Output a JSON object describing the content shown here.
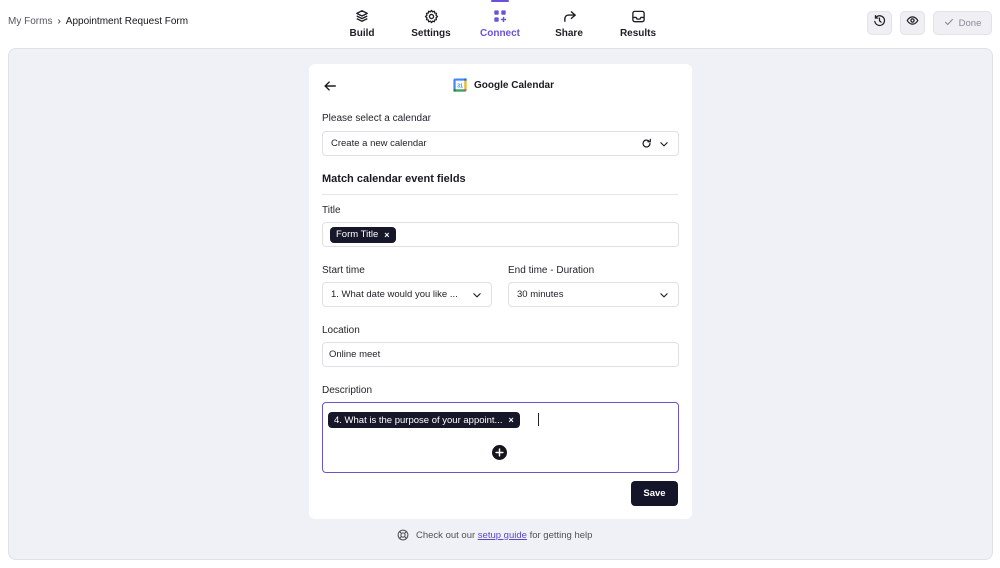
{
  "breadcrumb": {
    "root": "My Forms",
    "separator": "›",
    "current": "Appointment Request Form"
  },
  "nav": {
    "tabs": [
      {
        "label": "Build",
        "icon": "layers-icon",
        "active": false
      },
      {
        "label": "Settings",
        "icon": "gear-icon",
        "active": false
      },
      {
        "label": "Connect",
        "icon": "grid-plus-icon",
        "active": true
      },
      {
        "label": "Share",
        "icon": "share-arrow-icon",
        "active": false
      },
      {
        "label": "Results",
        "icon": "inbox-icon",
        "active": false
      }
    ]
  },
  "actions": {
    "history_icon": "history-icon",
    "preview_icon": "eye-icon",
    "done_label": "Done"
  },
  "panel": {
    "title": "Google Calendar",
    "calendar_label": "Please select a calendar",
    "calendar_value": "Create a new calendar",
    "section_title": "Match calendar event fields",
    "title_label": "Title",
    "title_chip": "Form Title",
    "start_label": "Start time",
    "start_value": "1. What date would you like ...",
    "end_label": "End time - Duration",
    "end_value": "30 minutes",
    "location_label": "Location",
    "location_value": "Online meet",
    "description_label": "Description",
    "description_chip": "4. What is the purpose of your appoint...",
    "chip_remove": "×",
    "save_label": "Save"
  },
  "help": {
    "prefix": "Check out our",
    "link": "setup guide",
    "suffix": "for getting help"
  },
  "colors": {
    "accent": "#6a52d8",
    "dark": "#15152a",
    "canvas": "#f0f1f6"
  }
}
